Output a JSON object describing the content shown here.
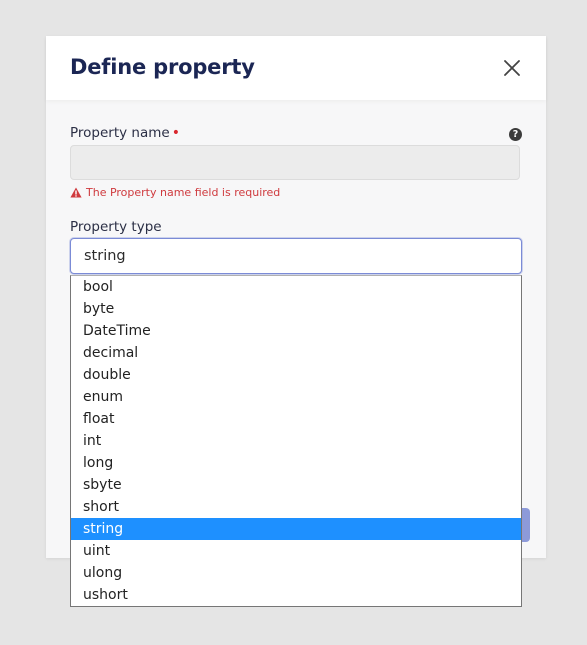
{
  "dialog": {
    "title": "Define property",
    "close_icon": "close-icon"
  },
  "property_name": {
    "label": "Property name",
    "required_marker": "•",
    "help_icon": "?",
    "value": "",
    "error": "The Property name field is required"
  },
  "property_type": {
    "label": "Property type",
    "selected": "string",
    "options": [
      "bool",
      "byte",
      "DateTime",
      "decimal",
      "double",
      "enum",
      "float",
      "int",
      "long",
      "sbyte",
      "short",
      "string",
      "uint",
      "ulong",
      "ushort"
    ]
  },
  "colors": {
    "title": "#1b2654",
    "error": "#cf3a3e",
    "selected_option": "#1e90ff",
    "required": "#d9272e"
  }
}
